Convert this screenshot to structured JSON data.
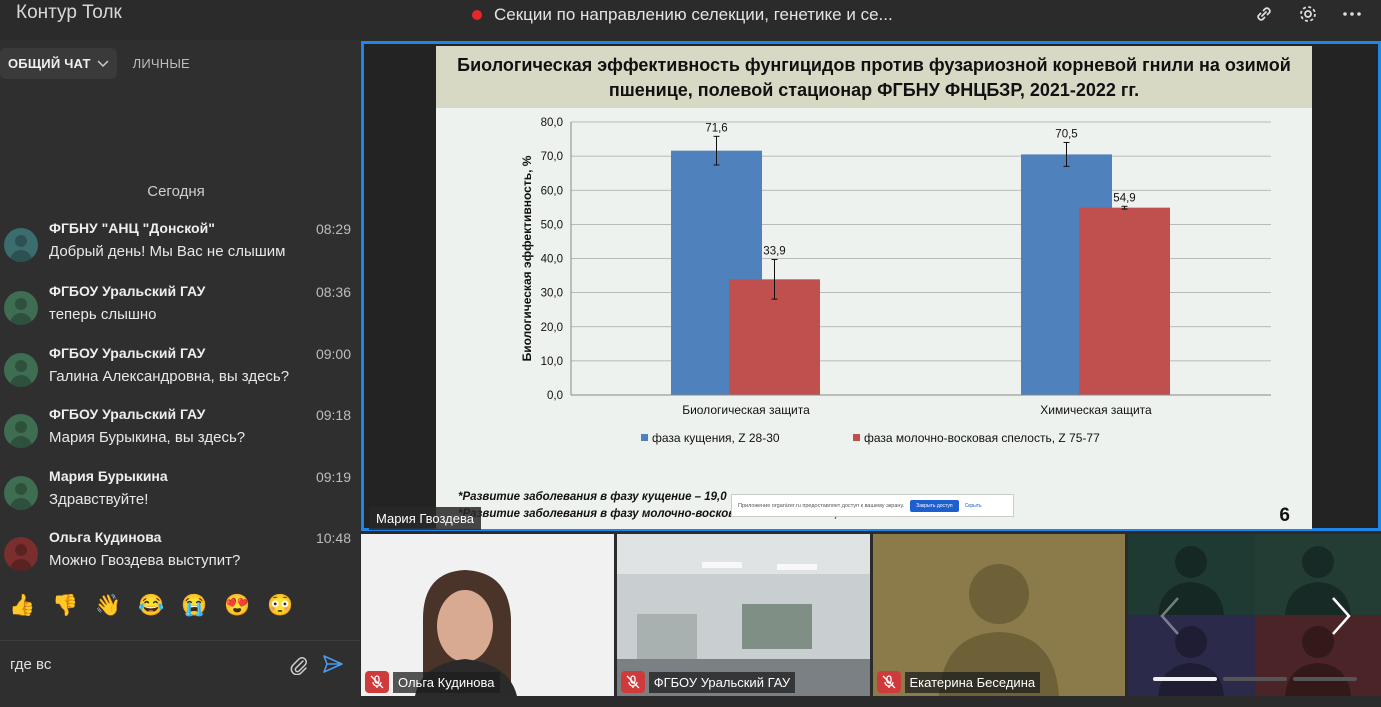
{
  "app": {
    "title": "Контур Толк"
  },
  "meeting": {
    "title": "Секции по направлению селекции, генетике и се..."
  },
  "topbar": {
    "icons": [
      "link-icon",
      "gear-icon",
      "more-icon"
    ]
  },
  "chat": {
    "tabs": [
      {
        "label": "ОБЩИЙ ЧАТ",
        "active": true
      },
      {
        "label": "ЛИЧНЫЕ",
        "active": false
      }
    ],
    "day_label": "Сегодня",
    "messages": [
      {
        "sender": "ФГБНУ \"АНЦ \"Донской\"",
        "time": "08:29",
        "text": "Добрый день! Мы Вас не слышим"
      },
      {
        "sender": "ФГБОУ Уральский ГАУ",
        "time": "08:36",
        "text": "теперь слышно"
      },
      {
        "sender": "ФГБОУ Уральский ГАУ",
        "time": "09:00",
        "text": "Галина Александровна, вы здесь?"
      },
      {
        "sender": "ФГБОУ Уральский ГАУ",
        "time": "09:18",
        "text": "Мария Бурыкина, вы здесь?"
      },
      {
        "sender": "Мария Бурыкина",
        "time": "09:19",
        "text": "Здравствуйте!"
      },
      {
        "sender": "Ольга Кудинова",
        "time": "10:48",
        "text": "Можно Гвоздева выступит?"
      }
    ],
    "reactions": [
      "👍",
      "👎",
      "👋",
      "😂",
      "😭",
      "😍",
      "😳"
    ],
    "composer": {
      "value": "где вс"
    }
  },
  "slide": {
    "title_line1": "Биологическая эффективность фунгицидов против фузариозной корневой гнили на озимой",
    "title_line2": "пшенице, полевой стационар ФГБНУ ФНЦБЗР, 2021-2022 гг.",
    "note1": "*Развитие заболевания в фазу кущение – 19,0",
    "note2": "*Развитие заболевания  в фазу молочно-восковая спелость – 35,4 %",
    "popup_text": "Приложение organizer.ru предоставляет доступ к вашему экрану.",
    "popup_button": "Закрыть доступ",
    "popup_link": "Скрыть",
    "slide_number": "6",
    "speaker": "Мария Гвоздева"
  },
  "chart_data": {
    "type": "bar",
    "title": "",
    "ylabel": "Биологическая эффективность, %",
    "xlabel": "",
    "ylim": [
      0,
      80
    ],
    "yticks": [
      "0,0",
      "10,0",
      "20,0",
      "30,0",
      "40,0",
      "50,0",
      "60,0",
      "70,0",
      "80,0"
    ],
    "categories": [
      "Биологическая защита",
      "Химическая защита"
    ],
    "series": [
      {
        "name": "фаза кущения, Z 28-30",
        "color": "#4f81bd",
        "values": [
          71.6,
          70.5
        ],
        "labels": [
          "71,6",
          "70,5"
        ],
        "errors": [
          4.2,
          3.5
        ]
      },
      {
        "name": "фаза молочно-восковая спелость, Z 75-77",
        "color": "#c0504d",
        "values": [
          33.9,
          54.9
        ],
        "labels": [
          "33,9",
          "54,9"
        ],
        "errors": [
          5.8,
          0.4
        ]
      }
    ],
    "legend": "bottom",
    "grid": true
  },
  "participants": [
    {
      "name": "Ольга Кудинова",
      "mic_off": true
    },
    {
      "name": "ФГБОУ Уральский ГАУ",
      "mic_off": true
    },
    {
      "name": "Екатерина Беседина",
      "mic_off": true
    },
    {
      "name": "",
      "mic_off": false
    }
  ]
}
